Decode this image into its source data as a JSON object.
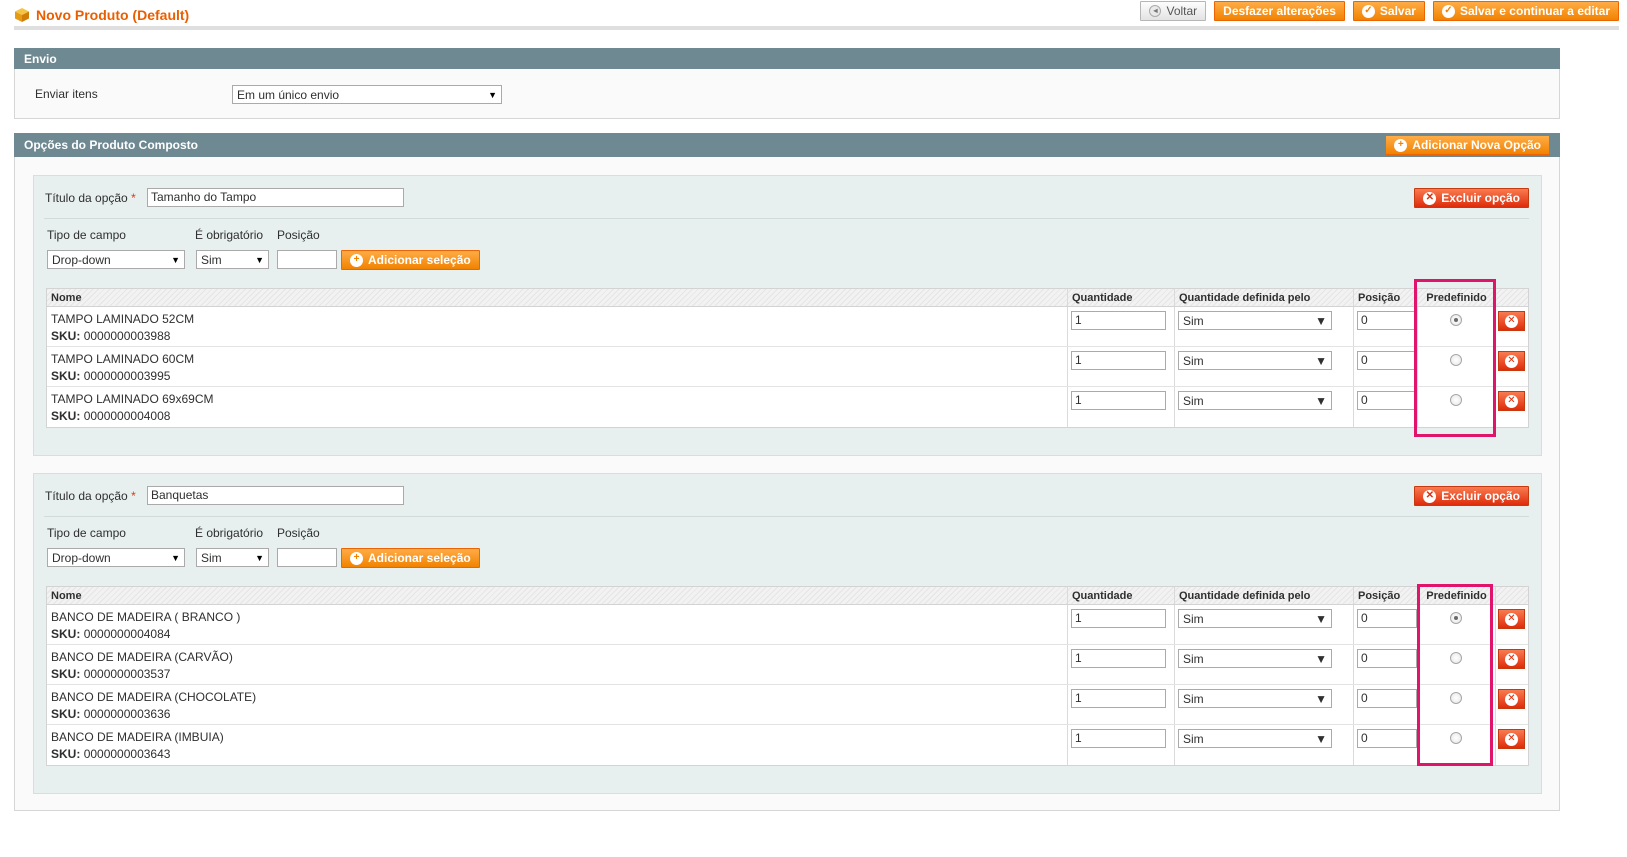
{
  "header": {
    "title": "Novo Produto (Default)",
    "buttons": {
      "back": "Voltar",
      "reset": "Desfazer alterações",
      "save": "Salvar",
      "save_continue": "Salvar e continuar a editar"
    }
  },
  "shipment": {
    "section_title": "Envio",
    "label": "Enviar itens",
    "value": "Em um único envio"
  },
  "bundle": {
    "section_title": "Opções do Produto Composto",
    "add_option_label": "Adicionar Nova Opção",
    "option_title_label": "Título da opção",
    "required_mark": "*",
    "delete_option_label": "Excluir opção",
    "field_type_label": "Tipo de campo",
    "is_required_label": "É obrigatório",
    "position_label": "Posição",
    "add_selection_label": "Adicionar seleção",
    "columns": {
      "name": "Nome",
      "default_qty": "Quantidade padrão",
      "user_defined_qty": "Quantidade definida pelo usuário",
      "position": "Posição",
      "default": "Predefinido"
    },
    "sku_label": "SKU:",
    "options": [
      {
        "title": "Tamanho do Tampo",
        "field_type": "Drop-down",
        "is_required": "Sim",
        "position": "",
        "selections": [
          {
            "name": "TAMPO LAMINADO 52CM",
            "sku": "0000000003988",
            "qty": "1",
            "user_qty": "Sim",
            "position": "0",
            "default": true
          },
          {
            "name": "TAMPO LAMINADO 60CM",
            "sku": "0000000003995",
            "qty": "1",
            "user_qty": "Sim",
            "position": "0",
            "default": false
          },
          {
            "name": "TAMPO LAMINADO 69x69CM",
            "sku": "0000000004008",
            "qty": "1",
            "user_qty": "Sim",
            "position": "0",
            "default": false
          }
        ]
      },
      {
        "title": "Banquetas",
        "field_type": "Drop-down",
        "is_required": "Sim",
        "position": "",
        "selections": [
          {
            "name": "BANCO DE MADEIRA ( BRANCO )",
            "sku": "0000000004084",
            "qty": "1",
            "user_qty": "Sim",
            "position": "0",
            "default": true
          },
          {
            "name": "BANCO DE MADEIRA (CARVÃO)",
            "sku": "0000000003537",
            "qty": "1",
            "user_qty": "Sim",
            "position": "0",
            "default": false
          },
          {
            "name": "BANCO DE MADEIRA (CHOCOLATE)",
            "sku": "0000000003636",
            "qty": "1",
            "user_qty": "Sim",
            "position": "0",
            "default": false
          },
          {
            "name": "BANCO DE MADEIRA (IMBUIA)",
            "sku": "0000000003643",
            "qty": "1",
            "user_qty": "Sim",
            "position": "0",
            "default": false
          }
        ]
      }
    ]
  },
  "colors": {
    "accent": "#eb5e00",
    "section_header": "#6f8992",
    "highlight": "#e0146a"
  }
}
